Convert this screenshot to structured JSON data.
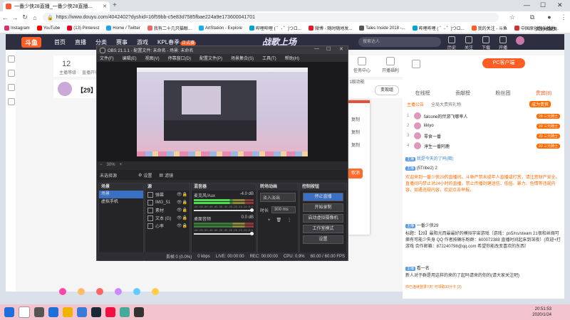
{
  "browser": {
    "tab_title": "一番少侠28直播_一番少侠28直播...",
    "url": "https://www.douyu.com/4042402?dyshid=16f59bb-c5e83d7585fbae224a9e173600041701",
    "bookmarks": [
      {
        "label": "Instagram",
        "color": "#d6336c"
      },
      {
        "label": "YouTube",
        "color": "#ff0000"
      },
      {
        "label": "(13) Pinterest",
        "color": "#e60023"
      },
      {
        "label": "Home / Twitter",
        "color": "#1da1f2"
      },
      {
        "label": "我有二十几只猫眼...",
        "color": "#e66"
      },
      {
        "label": "ArtStation - Explore",
        "color": "#13aff0"
      },
      {
        "label": "哔哩哔哩 ( ゜- ゜)つロ...",
        "color": "#00a1d6"
      },
      {
        "label": "微博 - 随时随地发...",
        "color": "#e6162d"
      },
      {
        "label": "Tales Inside 2018 -...",
        "color": "#555"
      },
      {
        "label": "哔哩哔哩 ( ゜- ゜)つロ...",
        "color": "#00a1d6"
      },
      {
        "label": "我的关注 - 斗鱼",
        "color": "#ff5d23"
      },
      {
        "label": "中国原创音乐基地...",
        "color": "#c33"
      }
    ],
    "other_bookmarks": "其他收藏夹"
  },
  "site": {
    "logo": "斗鱼",
    "nav": [
      "首页",
      "直播",
      "分类",
      "赛事",
      "游戏",
      "KPL春季"
    ],
    "nav_badge": "正式赛",
    "search_placeholder": "搜索达人",
    "header_icons": [
      "历史",
      "关注",
      "下载",
      "开播"
    ],
    "header_banner": "战歌上场"
  },
  "stream": {
    "count": "12",
    "count_label": "主播等级",
    "title": "【29】最",
    "hot_label": "直播开创",
    "dept_btn": "变现组",
    "level_btn": "1级功能",
    "right_icons": [
      "直播间任务",
      "鱼塘",
      "任务中心",
      "开播福利"
    ],
    "pc_btn": "PC客户端"
  },
  "side_panel": {
    "tabs": [
      "在线榜",
      "贡献榜",
      "粉丝团",
      "贵宾(8)"
    ],
    "intro_label": "主播公告",
    "intro_text": "全局大贵宾礼物",
    "rank_badge_label": "成为贵宾",
    "ranks": [
      {
        "n": "1",
        "name": "falcone的伴游飞哪率人",
        "badge": "28 三元骑士"
      },
      {
        "n": "2",
        "name": "kkiyo",
        "badge": "20 三元骑士"
      },
      {
        "n": "3",
        "name": "零食一番",
        "badge": "20 三元骑士"
      },
      {
        "n": "4",
        "name": "淳生一番阿鹿",
        "badge": "20 三元骑士"
      }
    ],
    "chat": [
      {
        "tag": "主播",
        "text": "我是今天的了吗(暗)"
      },
      {
        "tag": "主播",
        "text": "(5Tribe2) 2"
      },
      {
        "tag": "",
        "text": "欢迎来到一番少侠29的直播间。斗鱼严禁未成年人直播或打赏，请注意财产安全。直播间内禁止对24小时的直播，禁止传播封建迷信、低俗、暴力、色情等违规内容，如遇违规内容，欢迎点击举报。"
      },
      {
        "tag": "主播",
        "text": "一番少侠29"
      },
      {
        "tag": "",
        "text": "标题：【29】最阳光而最最好的模拟宇宙游戏（游戏：ps5/ns/steam 21很和丝绸可撕有可能少失身 QQ 作者按确乐粉群：600072388 直播时间起床到深夜）(欢迎+打游戏 合作邮箱：872240798@qq.com 希望你能改变喜欢的东西）"
      },
      {
        "tag": "主播",
        "text": "看一名"
      },
      {
        "tag": "",
        "text": "新人对于群是用这样的来的了起吗请来的你的(请大家关注吧)"
      }
    ],
    "footer_link": "你已连续登录7天! 可领取30分卡 (3)"
  },
  "taskbar": {
    "time": "20:51:53",
    "date": "2020/1/24"
  },
  "obs": {
    "title": "OBS 21.1.1 - 配置文件: 未命名 - 场景: 未命名",
    "menu": [
      "文件(F)",
      "编辑(E)",
      "视图(V)",
      "停靠窗口(D)",
      "配置文件(P)",
      "场景集合(S)",
      "工具(T)",
      "帮助(H)"
    ],
    "zoom": "30%",
    "no_scene": "未选择源",
    "props_btn": "设置",
    "filters_btn": "滤镜",
    "scenes_title": "场景",
    "scenes": [
      "场景",
      "虚拟手机"
    ],
    "sources_title": "源",
    "sources": [
      "弹幕",
      "IMG_51",
      "素材",
      "文本 (G)",
      "心率"
    ],
    "mixer_title": "混音器",
    "mixer_tracks": [
      {
        "name": "麦克风/Aux",
        "db": "-4.0 dB",
        "level": 0.6
      },
      {
        "name": "桌面音频",
        "db": "0.0 dB",
        "level": 0.0
      }
    ],
    "meter_scale": "-60 -55 -50 -45 -40 -35 -30 -25 -20 -15 -10 -5 0",
    "transitions_title": "转场动画",
    "transition_value": "淡入淡出",
    "duration_label": "时长",
    "duration_value": "300 ms",
    "controls_title": "控制按钮",
    "controls": [
      "停止直播",
      "开始录制",
      "启动虚拟摄像机",
      "工作室模式",
      "设置"
    ],
    "status": {
      "dropped": "丢帧 0 (0.0%)",
      "kbps": "0 kbps",
      "live": "LIVE: 00:00:00",
      "rec": "REC: 00:00:00",
      "cpu": "CPU: 0.9%",
      "fps": "60.00 / 60.00 FPS"
    }
  },
  "side_dialog": {
    "rows": [
      "复制",
      "复制",
      "复制"
    ],
    "button": "取消"
  }
}
